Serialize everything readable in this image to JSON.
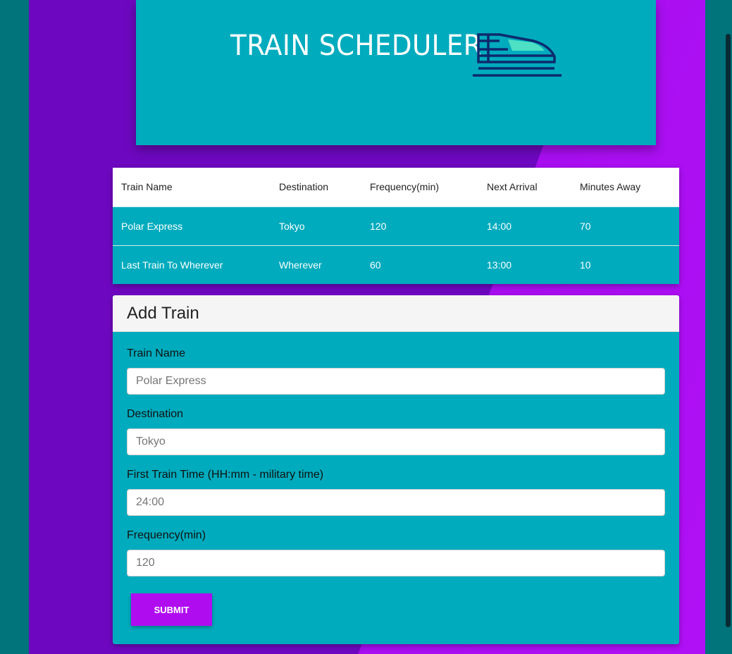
{
  "header": {
    "title": "TRAIN SCHEDULER"
  },
  "table": {
    "columns": [
      "Train Name",
      "Destination",
      "Frequency(min)",
      "Next Arrival",
      "Minutes Away"
    ],
    "rows": [
      [
        "Polar Express",
        "Tokyo",
        "120",
        "14:00",
        "70"
      ],
      [
        "Last Train To Wherever",
        "Wherever",
        "60",
        "13:00",
        "10"
      ]
    ]
  },
  "form": {
    "title": "Add Train",
    "fields": [
      {
        "label": "Train Name",
        "value": "Polar Express"
      },
      {
        "label": "Destination",
        "value": "Tokyo"
      },
      {
        "label": "First Train Time (HH:mm - military time)",
        "value": "24:00"
      },
      {
        "label": "Frequency(min)",
        "value": "120"
      }
    ],
    "submit_label": "SUBMIT"
  },
  "colors": {
    "accent": "#00abbd",
    "purple": "#6e08c0",
    "button": "#b00cf0"
  },
  "icons": {
    "logo": "bullet-train-icon"
  }
}
